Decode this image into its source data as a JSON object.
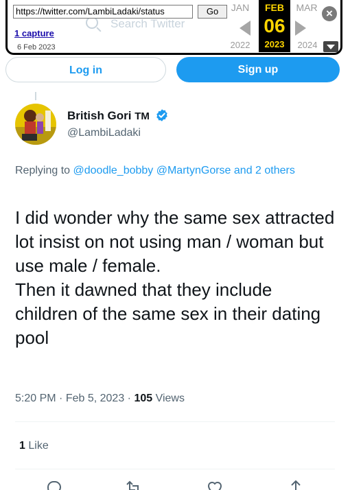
{
  "wayback": {
    "url": "https://twitter.com/LambiLadaki/status",
    "go_label": "Go",
    "captures_label": "1 capture",
    "capture_date": "6 Feb 2023",
    "prev_month": "JAN",
    "current_month": "FEB",
    "next_month": "MAR",
    "current_day": "06",
    "prev_year": "2022",
    "current_year": "2023",
    "next_year": "2024",
    "close_icon": "close-icon",
    "accent": "#ffd600"
  },
  "page_search_placeholder": "Search Twitter",
  "auth": {
    "login_label": "Log in",
    "signup_label": "Sign up",
    "brand_color": "#1d9bf0"
  },
  "tweet": {
    "display_name": "British Gori",
    "name_suffix": "TM",
    "handle": "@LambiLadaki",
    "replying_prefix": "Replying to",
    "replying_to": [
      "@doodle_bobby",
      "@MartynGorse"
    ],
    "replying_suffix": "and 2 others",
    "text_lines": [
      "I did wonder why the same sex attracted lot insist on not using man / woman but use male / female.",
      "Then it dawned that they include children of the same sex in their dating pool"
    ],
    "time": "5:20 PM",
    "date": "Feb 5, 2023",
    "views_count": "105",
    "views_label": "Views",
    "likes_count": "1",
    "likes_label": "Like"
  }
}
